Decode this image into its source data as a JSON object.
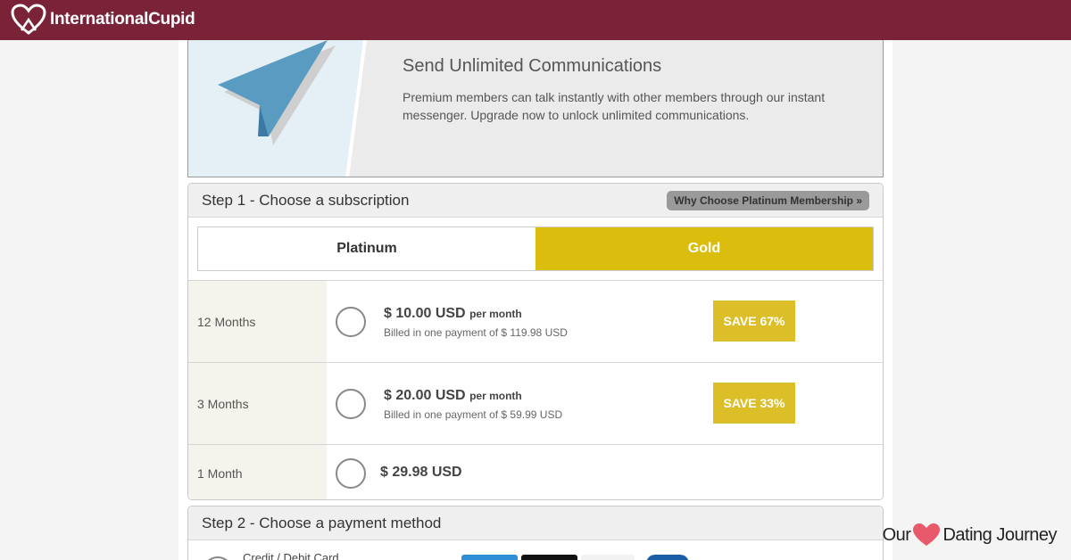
{
  "header": {
    "logo_text": "InternationalCupid",
    "icon": "heart-logo-icon",
    "background_color": "#7a2338"
  },
  "banner": {
    "icon": "paper-plane-icon",
    "title": "Send Unlimited Communications",
    "description": "Premium members can talk instantly with other members through our instant messenger. Upgrade now to unlock unlimited communications."
  },
  "step1": {
    "title": "Step 1 - Choose a subscription",
    "why_button": "Why Choose Platinum Membership »",
    "tabs": [
      {
        "label": "Platinum",
        "active": false
      },
      {
        "label": "Gold",
        "active": true
      }
    ],
    "plans": [
      {
        "duration": "12 Months",
        "price": "$ 10.00 USD",
        "per": "per month",
        "billed": "Billed in one payment of $ 119.98 USD",
        "save": "SAVE 67%"
      },
      {
        "duration": "3 Months",
        "price": "$ 20.00 USD",
        "per": "per month",
        "billed": "Billed in one payment of $ 59.99 USD",
        "save": "SAVE 33%"
      },
      {
        "duration": "1 Month",
        "price": "$ 29.98 USD"
      }
    ],
    "accent_color": "#dbbd0e"
  },
  "step2": {
    "title": "Step 2 - Choose a payment method",
    "option_label": "Credit / Debit Card"
  },
  "watermark": {
    "left": "Our",
    "right": "Dating Journey",
    "icon": "heart-icon"
  }
}
